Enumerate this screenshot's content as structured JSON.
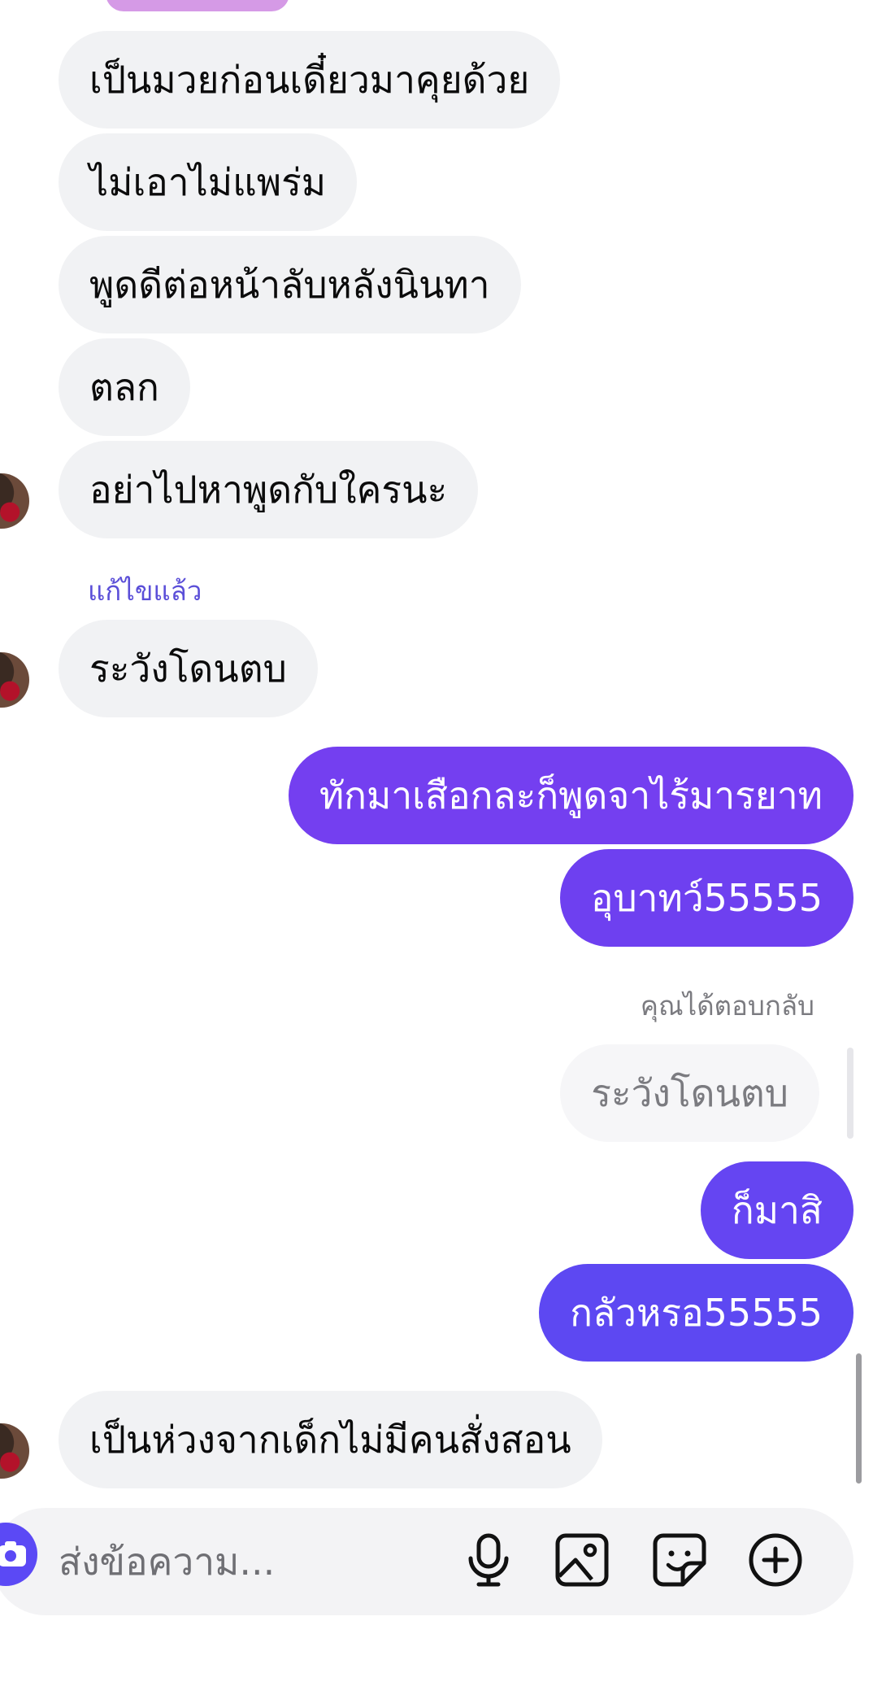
{
  "messages_in": [
    {
      "text": "เป็นมวยก่อนเดี๋ยวมาคุยด้วย"
    },
    {
      "text": "ไม่เอาไม่แพร่ม"
    },
    {
      "text": "พูดดีต่อหน้าลับหลังนินทา"
    },
    {
      "text": "ตลก"
    },
    {
      "text": "อย่าไปหาพูดกับใครนะ"
    },
    {
      "text": "ระวังโดนตบ"
    },
    {
      "text": "เป็นห่วงจากเด็กไม่มีคนสั่งสอน"
    }
  ],
  "edited_label": "แก้ไขแล้ว",
  "messages_out": [
    {
      "text": "ทักมาเสือกละก็พูดจาไร้มารยาท"
    },
    {
      "text": "อุบาทว์55555"
    },
    {
      "text": "ก็มาสิ"
    },
    {
      "text": "กลัวหรอ55555"
    }
  ],
  "reply": {
    "label": "คุณได้ตอบกลับ",
    "quoted_text": "ระวังโดนตบ"
  },
  "composer": {
    "placeholder": "ส่งข้อความ..."
  },
  "colors": {
    "accent": "#5b49f5",
    "bubble_out_top": "#7a3ff0",
    "bubble_out_bottom": "#5a47f2",
    "bubble_in": "#f1f2f4",
    "edited_label": "#5b4fd8"
  },
  "icons": [
    "camera-icon",
    "microphone-icon",
    "image-icon",
    "sticker-icon",
    "plus-circle-icon"
  ]
}
